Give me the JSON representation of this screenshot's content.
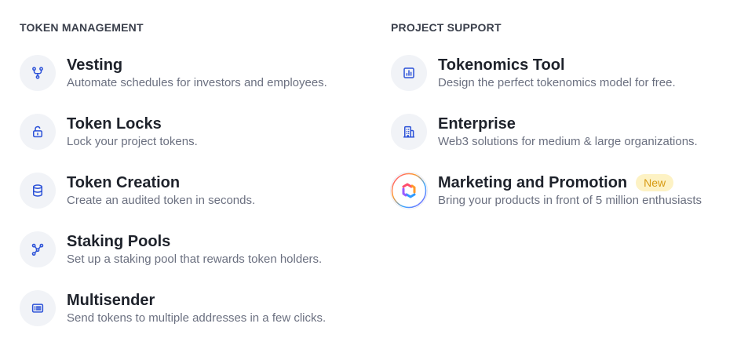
{
  "colors": {
    "icon_blue": "#2c52d8",
    "icon_bg": "#f1f3f7",
    "badge_bg": "#fdf2c4",
    "badge_text": "#d79a12"
  },
  "token_management": {
    "title": "TOKEN MANAGEMENT",
    "items": [
      {
        "icon": "branch-icon",
        "title": "Vesting",
        "description": "Automate schedules for investors and employees."
      },
      {
        "icon": "lock-icon",
        "title": "Token Locks",
        "description": "Lock your project tokens."
      },
      {
        "icon": "database-icon",
        "title": "Token Creation",
        "description": "Create an audited token in seconds."
      },
      {
        "icon": "nodes-icon",
        "title": "Staking Pools",
        "description": "Set up a staking pool that rewards token holders."
      },
      {
        "icon": "list-icon",
        "title": "Multisender",
        "description": "Send tokens to multiple addresses in a few clicks."
      }
    ]
  },
  "project_support": {
    "title": "PROJECT SUPPORT",
    "items": [
      {
        "icon": "bar-chart-icon",
        "title": "Tokenomics Tool",
        "description": "Design the perfect tokenomics model for free."
      },
      {
        "icon": "building-icon",
        "title": "Enterprise",
        "description": "Web3 solutions for medium & large organizations."
      },
      {
        "icon": "brand-logo-icon",
        "title": "Marketing and Promotion",
        "badge": "New",
        "description": "Bring your products in front of 5 million enthusiasts"
      }
    ]
  }
}
